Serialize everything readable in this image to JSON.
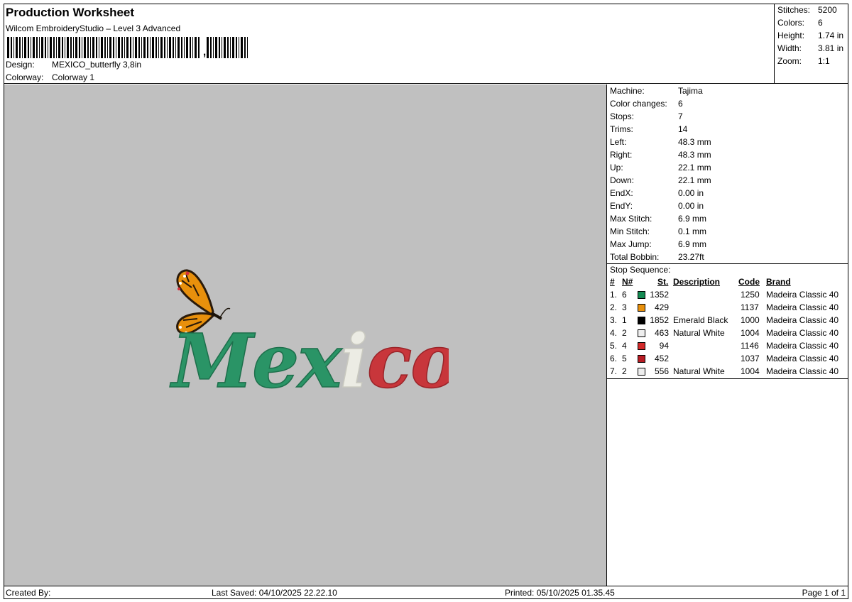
{
  "header": {
    "title": "Production Worksheet",
    "subtitle": "Wilcom EmbroideryStudio – Level 3 Advanced",
    "barcode_tail": ",",
    "design_label": "Design:",
    "design_value": "MEXICO_butterfly 3,8in",
    "colorway_label": "Colorway:",
    "colorway_value": "Colorway 1"
  },
  "stats": [
    {
      "label": "Stitches:",
      "value": "5200"
    },
    {
      "label": "Colors:",
      "value": "6"
    },
    {
      "label": "Height:",
      "value": "1.74 in"
    },
    {
      "label": "Width:",
      "value": "3.81 in"
    },
    {
      "label": "Zoom:",
      "value": "1:1"
    }
  ],
  "machine": [
    {
      "label": "Machine:",
      "value": "Tajima"
    },
    {
      "label": "Color changes:",
      "value": "6"
    },
    {
      "label": "Stops:",
      "value": "7"
    },
    {
      "label": "Trims:",
      "value": "14"
    },
    {
      "label": "Left:",
      "value": "48.3 mm"
    },
    {
      "label": "Right:",
      "value": "48.3 mm"
    },
    {
      "label": "Up:",
      "value": "22.1 mm"
    },
    {
      "label": "Down:",
      "value": "22.1 mm"
    },
    {
      "label": "EndX:",
      "value": "0.00 in"
    },
    {
      "label": "EndY:",
      "value": "0.00 in"
    },
    {
      "label": "Max Stitch:",
      "value": "6.9 mm"
    },
    {
      "label": "Min Stitch:",
      "value": "0.1 mm"
    },
    {
      "label": "Max Jump:",
      "value": "6.9 mm"
    },
    {
      "label": "Total Bobbin:",
      "value": "23.27ft"
    }
  ],
  "stop_sequence": {
    "title": "Stop Sequence:",
    "headers": {
      "num": "#",
      "n": "N#",
      "st": "St.",
      "desc": "Description",
      "code": "Code",
      "brand": "Brand"
    },
    "rows": [
      {
        "num": "1.",
        "n": "6",
        "color": "#138a52",
        "st": "1352",
        "desc": "",
        "code": "1250",
        "brand": "Madeira Classic 40"
      },
      {
        "num": "2.",
        "n": "3",
        "color": "#e8900c",
        "st": "429",
        "desc": "",
        "code": "1137",
        "brand": "Madeira Classic 40"
      },
      {
        "num": "3.",
        "n": "1",
        "color": "#000000",
        "st": "1852",
        "desc": "Emerald Black",
        "code": "1000",
        "brand": "Madeira Classic 40"
      },
      {
        "num": "4.",
        "n": "2",
        "color": "#eeeeee",
        "st": "463",
        "desc": "Natural White",
        "code": "1004",
        "brand": "Madeira Classic 40"
      },
      {
        "num": "5.",
        "n": "4",
        "color": "#d22a2a",
        "st": "94",
        "desc": "",
        "code": "1146",
        "brand": "Madeira Classic 40"
      },
      {
        "num": "6.",
        "n": "5",
        "color": "#b81c24",
        "st": "452",
        "desc": "",
        "code": "1037",
        "brand": "Madeira Classic 40"
      },
      {
        "num": "7.",
        "n": "2",
        "color": "#eeeeee",
        "st": "556",
        "desc": "Natural White",
        "code": "1004",
        "brand": "Madeira Classic 40"
      }
    ]
  },
  "design": {
    "text_parts": [
      "Mex",
      "i",
      "co"
    ],
    "colors": {
      "green": "#2a9466",
      "white": "#ecece4",
      "red": "#c8363b",
      "orange": "#e8900c"
    }
  },
  "footer": {
    "created_by": "Created By:",
    "last_saved": "Last Saved: 04/10/2025 22.22.10",
    "printed": "Printed: 05/10/2025 01.35.45",
    "page": "Page 1 of 1"
  }
}
